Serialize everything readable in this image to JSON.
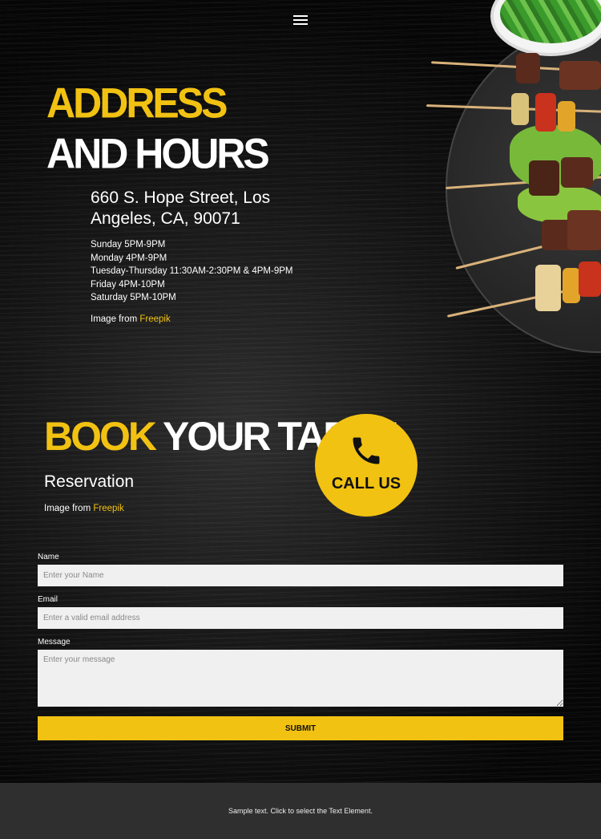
{
  "header": {
    "menu_icon": "hamburger-menu-icon"
  },
  "address_section": {
    "title_line1": "ADDRESS",
    "title_line2": "AND HOURS",
    "street": "660 S. Hope Street, Los Angeles, CA, 90071",
    "hours": [
      "Sunday 5PM-9PM",
      "Monday 4PM-9PM",
      "Tuesday-Thursday 11:30AM-2:30PM & 4PM-9PM",
      "Friday 4PM-10PM",
      "Saturday 5PM-10PM"
    ],
    "credit_prefix": "Image from",
    "credit_link": "Freepik"
  },
  "booking_section": {
    "title_yellow": "BOOK",
    "title_white": "YOUR TABLE",
    "subtitle": "Reservation",
    "credit_prefix": "Image from",
    "credit_link": "Freepik",
    "call_button_label": "CALL US",
    "call_icon": "phone-icon"
  },
  "form": {
    "name_label": "Name",
    "name_placeholder": "Enter your Name",
    "email_label": "Email",
    "email_placeholder": "Enter a valid email address",
    "message_label": "Message",
    "message_placeholder": "Enter your message",
    "submit_label": "SUBMIT"
  },
  "footer": {
    "text": "Sample text. Click to select the Text Element."
  },
  "colors": {
    "accent": "#f2c212",
    "background": "#111111",
    "footer": "#2f2f2f"
  }
}
